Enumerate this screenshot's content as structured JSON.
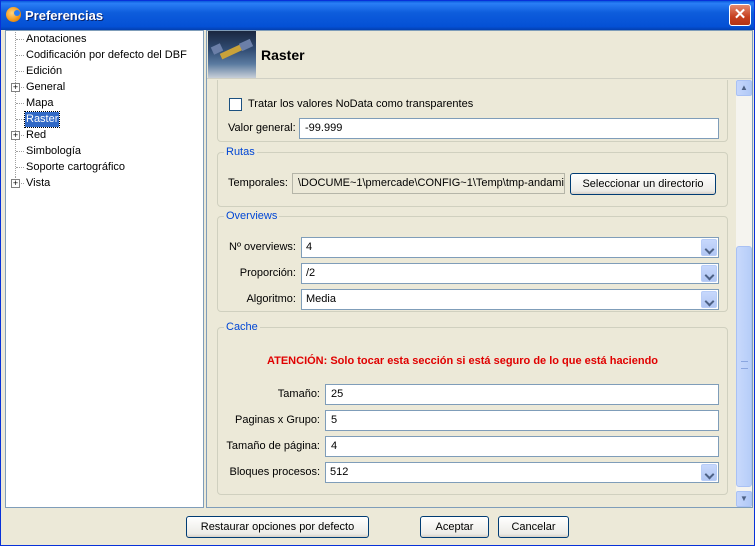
{
  "window": {
    "title": "Preferencias",
    "close_label": "✕"
  },
  "tree": {
    "items": [
      {
        "label": "Anotaciones",
        "expandable": false,
        "selected": false
      },
      {
        "label": "Codificación por defecto del DBF",
        "expandable": false,
        "selected": false
      },
      {
        "label": "Edición",
        "expandable": false,
        "selected": false
      },
      {
        "label": "General",
        "expandable": true,
        "selected": false
      },
      {
        "label": "Mapa",
        "expandable": false,
        "selected": false
      },
      {
        "label": "Raster",
        "expandable": false,
        "selected": true
      },
      {
        "label": "Red",
        "expandable": true,
        "selected": false
      },
      {
        "label": "Simbología",
        "expandable": false,
        "selected": false
      },
      {
        "label": "Soporte cartográfico",
        "expandable": false,
        "selected": false
      },
      {
        "label": "Vista",
        "expandable": true,
        "selected": false
      }
    ],
    "expander_symbol": "+"
  },
  "panel": {
    "title": "Raster"
  },
  "nodata": {
    "checkbox_label": "Tratar los valores NoData como transparentes",
    "checked": false,
    "general_label": "Valor general:",
    "general_value": "-99.999"
  },
  "rutas": {
    "title": "Rutas",
    "temporales_label": "Temporales:",
    "temporales_value": "\\DOCUME~1\\pmercade\\CONFIG~1\\Temp\\tmp-andami",
    "select_dir_button": "Seleccionar un directorio"
  },
  "overviews": {
    "title": "Overviews",
    "count_label": "Nº overviews:",
    "count_value": "4",
    "ratio_label": "Proporción:",
    "ratio_value": "/2",
    "algorithm_label": "Algoritmo:",
    "algorithm_value": "Media"
  },
  "cache": {
    "title": "Cache",
    "warning": "ATENCIÓN: Solo tocar esta sección si está seguro de lo que está haciendo",
    "size_label": "Tamaño:",
    "size_value": "25",
    "pages_label": "Paginas x Grupo:",
    "pages_value": "5",
    "page_size_label": "Tamaño de página:",
    "page_size_value": "4",
    "blocks_label": "Bloques procesos:",
    "blocks_value": "512"
  },
  "footer": {
    "restore_button": "Restaurar opciones por defecto",
    "accept_button": "Aceptar",
    "cancel_button": "Cancelar"
  },
  "colors": {
    "titlebar": "#0450d5",
    "selection": "#3169c6",
    "warning": "#e00000",
    "group_title": "#0046d5"
  }
}
